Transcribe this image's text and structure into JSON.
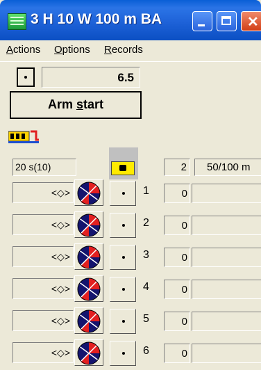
{
  "window": {
    "title": "3 H 10 W 100 m BA"
  },
  "menu": {
    "items": [
      "Actions",
      "Options",
      "Records"
    ]
  },
  "timer": {
    "value": "6.5"
  },
  "arm_button": {
    "label_pre": "Arm ",
    "label_key": "s",
    "label_post": "tart"
  },
  "interval": {
    "value": "20 s(10)"
  },
  "header_count": {
    "value": "2"
  },
  "distance": {
    "value": "50/100 m"
  },
  "lanes": [
    {
      "control": "<◇>",
      "number": "1",
      "count": "0"
    },
    {
      "control": "<◇>",
      "number": "2",
      "count": "0"
    },
    {
      "control": "<◇>",
      "number": "3",
      "count": "0"
    },
    {
      "control": "<◇>",
      "number": "4",
      "count": "0"
    },
    {
      "control": "<◇>",
      "number": "5",
      "count": "0"
    },
    {
      "control": "<◇>",
      "number": "6",
      "count": "0"
    }
  ],
  "colors": {
    "title_bar": "#1e62d8",
    "pie_red": "#e32020",
    "pie_navy": "#14146e",
    "header_icon": "#ffea00"
  }
}
